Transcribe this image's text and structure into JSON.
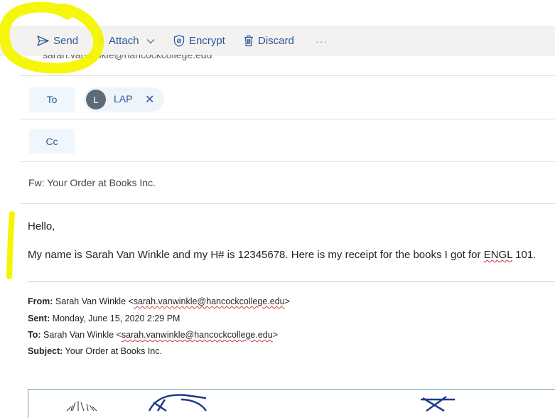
{
  "toolbar": {
    "send": "Send",
    "attach": "Attach",
    "encrypt": "Encrypt",
    "discard": "Discard",
    "more": "···"
  },
  "from_partial": "sarah.vanwinkle@hancockcollege.edu",
  "recipients": {
    "to_label": "To",
    "cc_label": "Cc",
    "to_chip": {
      "initial": "L",
      "name": "LAP",
      "remove": "✕"
    }
  },
  "subject": "Fw: Your Order at Books Inc.",
  "body": {
    "greeting": "Hello,",
    "line_before": "My name is Sarah Van Winkle and my H# is 12345678. Here is my receipt for the books I got for ",
    "line_flagged": "ENGL",
    "line_after": " 101."
  },
  "forwarded": {
    "from_label": "From:",
    "from_name": " Sarah Van Winkle <",
    "from_email": "sarah.vanwinkle@hancockcollege.edu",
    "from_close": ">",
    "sent_label": "Sent:",
    "sent_value": " Monday, June 15, 2020 2:29 PM",
    "to_label": "To:",
    "to_name": " Sarah Van Winkle <",
    "to_email": "sarah.vanwinkle@hancockcollege.edu",
    "to_close": ">",
    "subject_label": "Subject:",
    "subject_value": " Your Order at Books Inc."
  },
  "colors": {
    "accent": "#2b5797",
    "toolbar_bg": "#f3f2f1",
    "highlighter": "#f5f500",
    "spellcheck": "#d13438"
  }
}
